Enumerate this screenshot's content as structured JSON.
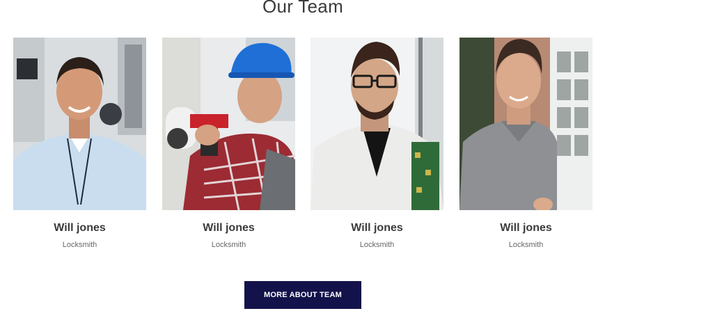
{
  "section": {
    "title": "Our Team"
  },
  "team": [
    {
      "name": "Will jones",
      "role": "Locksmith"
    },
    {
      "name": "Will jones",
      "role": "Locksmith"
    },
    {
      "name": "Will jones",
      "role": "Locksmith"
    },
    {
      "name": "Will jones",
      "role": "Locksmith"
    }
  ],
  "cta": {
    "label": "MORE ABOUT TEAM"
  },
  "colors": {
    "button_bg": "#13124a",
    "text": "#3b3b3b"
  }
}
